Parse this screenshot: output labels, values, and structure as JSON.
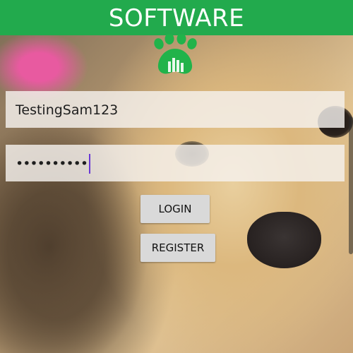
{
  "header": {
    "title": "SOFTWARE",
    "color": "#22aa4d"
  },
  "logo": {
    "icon": "paw-icon",
    "color": "#21b34a"
  },
  "form": {
    "username_value": "TestingSam123",
    "password_masked": "••••••••••",
    "login_label": "LOGIN",
    "register_label": "REGISTER",
    "caret_color": "#6a39d6"
  },
  "background": {
    "description_icon": "kitten-and-puppy-photo"
  }
}
